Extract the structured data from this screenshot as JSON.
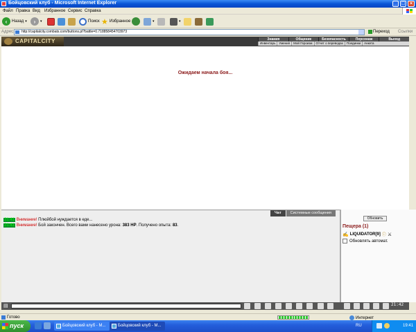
{
  "window": {
    "title": "Бойцовский клуб - Microsoft Internet Explorer"
  },
  "menu": [
    "Файл",
    "Правка",
    "Вид",
    "Избранное",
    "Сервис",
    "Справка"
  ],
  "toolbar": {
    "back": "Назад",
    "search": "Поиск",
    "favorites": "Избранное"
  },
  "address": {
    "label": "Адрес:",
    "url": "http://capitalcity.combats.com/buttons.pl?battle=0.718858454703973",
    "go": "Переход",
    "links": "Ссылки"
  },
  "game": {
    "logo": "CAPITALCITY",
    "nav": [
      "Знания",
      "Общение",
      "Безопасность",
      "Персонаж",
      "Выход"
    ],
    "subnav": [
      "Инвентарь",
      "Умения",
      "Мой Героизм",
      "Отчет о переводах",
      "Поединки",
      "Анкета"
    ],
    "waiting": "Ожидаем начала боя..."
  },
  "chat": {
    "tabs": [
      "Чат",
      "Системные сообщения"
    ],
    "messages": [
      {
        "time": "21:41",
        "warn": "Внимание!",
        "text": "Плюйбой нуждается в еде..."
      },
      {
        "time": "21:41",
        "warn": "Внимание!",
        "text_a": "Бой закончен. Всего вами нанесено урона:",
        "damage": "383 HP",
        "text_b": ". Получено опыта:",
        "exp": "83",
        "text_c": "."
      }
    ]
  },
  "panel": {
    "refresh": "Обновить",
    "location": "Пещера (1)",
    "player": "LIQUIDATOR[9]",
    "auto_refresh": "Обновлять автомат."
  },
  "game_clock": "21:42",
  "status": {
    "ready": "Готово",
    "zone": "Интернет"
  },
  "taskbar": {
    "start": "пуск",
    "tasks": [
      "Бойцовский клуб - М...",
      "Бойцовский клуб - М..."
    ],
    "lang": "RU",
    "time": "19:41"
  }
}
